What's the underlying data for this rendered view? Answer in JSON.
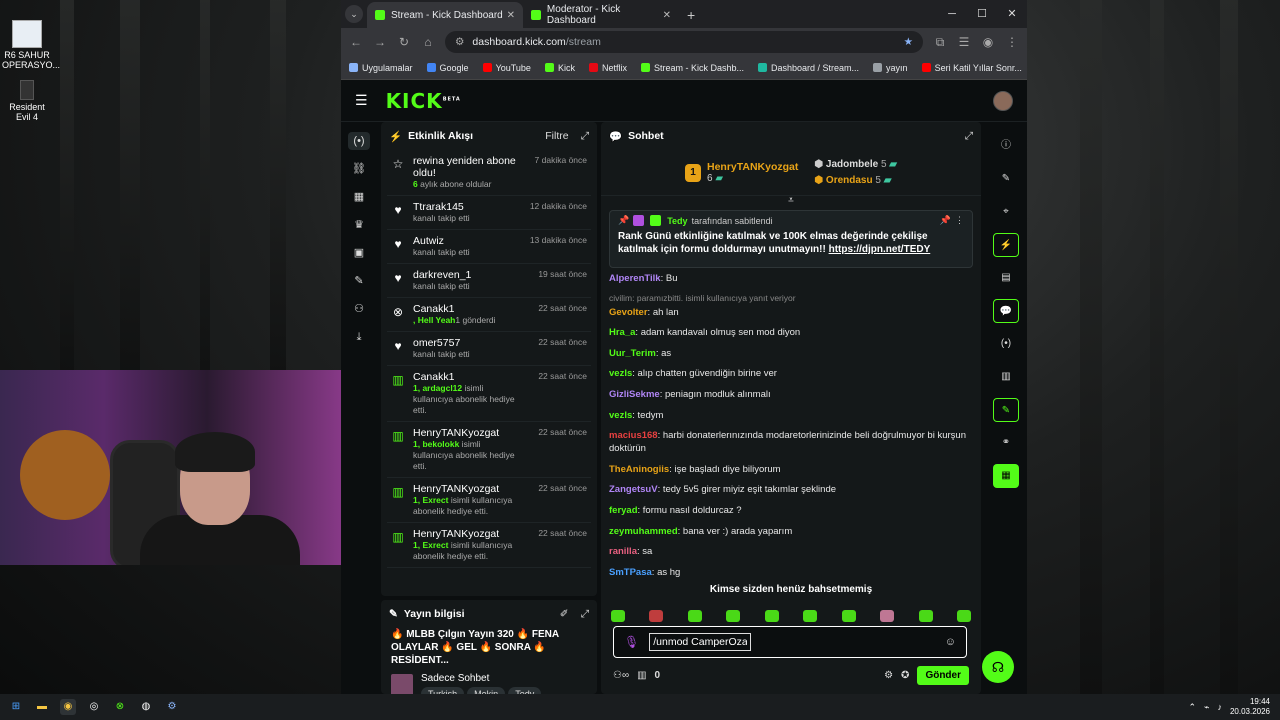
{
  "desktop": {
    "icons": [
      {
        "label": "R6 SAHUR OPERASYO..."
      },
      {
        "label": "Resident Evil 4"
      }
    ]
  },
  "browser": {
    "tabs": [
      {
        "label": "Stream - Kick Dashboard",
        "active": true
      },
      {
        "label": "Moderator - Kick Dashboard",
        "active": false
      }
    ],
    "url_domain": "dashboard.kick.com",
    "url_path": "/stream",
    "bookmarks": [
      {
        "label": "Uygulamalar",
        "color": "#8ab4f8"
      },
      {
        "label": "Google",
        "color": "#4285f4"
      },
      {
        "label": "YouTube",
        "color": "#ff0000"
      },
      {
        "label": "Kick",
        "color": "#53fc18"
      },
      {
        "label": "Netflix",
        "color": "#e50914"
      },
      {
        "label": "Stream - Kick Dashb...",
        "color": "#53fc18"
      },
      {
        "label": "Dashboard / Stream...",
        "color": "#1fb8a0"
      },
      {
        "label": "yayın",
        "color": "#9aa0a6"
      },
      {
        "label": "Seri Katil Yıllar Sonr...",
        "color": "#ff0000"
      }
    ]
  },
  "kick": {
    "logo": "KICK",
    "logo_sup": "BETA",
    "activity": {
      "title": "Etkinlik Akışı",
      "filter": "Filtre",
      "items": [
        {
          "title": "rewina yeniden abone oldu!",
          "sub_hl": "6",
          "sub": " aylık abone oldular",
          "time": "7 dakika önce",
          "icon": "star-icon"
        },
        {
          "title": "Ttrarak145",
          "sub_hl": "",
          "sub": "kanalı takip etti",
          "time": "12 dakika önce",
          "icon": "heart-icon"
        },
        {
          "title": "Autwiz",
          "sub_hl": "",
          "sub": "kanalı takip etti",
          "time": "13 dakika önce",
          "icon": "heart-icon"
        },
        {
          "title": "darkreven_1",
          "sub_hl": "",
          "sub": "kanalı takip etti",
          "time": "19 saat önce",
          "icon": "heart-icon"
        },
        {
          "title": "Canakk1",
          "sub_hl": ", Hell Yeah",
          "sub": "1 gönderdi",
          "time": "22 saat önce",
          "icon": "kick-coin-icon"
        },
        {
          "title": "omer5757",
          "sub_hl": "",
          "sub": "kanalı takip etti",
          "time": "22 saat önce",
          "icon": "heart-icon"
        },
        {
          "title": "Canakk1",
          "sub_hl": "1, ardagcl12",
          "sub": " isimli kullanıcıya abonelik hediye etti.",
          "time": "22 saat önce",
          "icon": "gift-icon"
        },
        {
          "title": "HenryTANKyozgat",
          "sub_hl": "1, bekolokk",
          "sub": " isimli kullanıcıya abonelik hediye etti.",
          "time": "22 saat önce",
          "icon": "gift-icon"
        },
        {
          "title": "HenryTANKyozgat",
          "sub_hl": "1, Exrect",
          "sub": " isimli kullanıcıya abonelik hediye etti.",
          "time": "22 saat önce",
          "icon": "gift-icon"
        },
        {
          "title": "HenryTANKyozgat",
          "sub_hl": "1, Exrect",
          "sub": " isimli kullanıcıya abonelik hediye etti.",
          "time": "22 saat önce",
          "icon": "gift-icon"
        }
      ]
    },
    "stream_info": {
      "title": "Yayın bilgisi",
      "stream_title": "🔥 MLBB Çılgın Yayın 320 🔥 FENA OLAYLAR 🔥 GEL 🔥 SONRA 🔥 RESİDENT...",
      "category": "Sadece Sohbet",
      "tags": [
        "Turkish",
        "Mekin",
        "Tedy"
      ]
    },
    "chat": {
      "title": "Sohbet",
      "leader": {
        "rank": "1",
        "name": "HenryTANKyozgat",
        "count": "6"
      },
      "runners": [
        {
          "name": "Jadombele",
          "count": "5",
          "color": "#dddddd"
        },
        {
          "name": "Orendasu",
          "count": "5",
          "color": "#e8a317"
        }
      ],
      "pinned_by": "Tedy",
      "pinned_by_suffix": " tarafından sabitlendi",
      "pinned_msg": "Rank Günü etkinliğine katılmak ve 100K elmas değerinde çekilişe katılmak için formu doldurmayı unutmayın!! ",
      "pinned_link": "https://djpn.net/TEDY",
      "reply_note": "civilim: paramızbitti. isimli kullanıcıya yanıt veriyor",
      "messages": [
        {
          "user": "AlperenTilk",
          "color": "#b085f5",
          "text": "Bu"
        },
        {
          "user": "Gevolter",
          "color": "#e8a317",
          "text": "ah lan"
        },
        {
          "user": "Hra_a",
          "color": "#53fc18",
          "text": "adam kandavalı olmuş sen mod diyon"
        },
        {
          "user": "Uur_Terim",
          "color": "#53fc18",
          "text": "as"
        },
        {
          "user": "vezls",
          "color": "#53fc18",
          "text": "alıp chatten güvendiğin birine ver"
        },
        {
          "user": "GizliSekme",
          "color": "#b085f5",
          "text": "peniagın modluk alınmalı"
        },
        {
          "user": "vezls",
          "color": "#53fc18",
          "text": "tedym"
        },
        {
          "user": "macius168",
          "color": "#e84040",
          "text": "harbi donaterlerınızında modaretorlerinizinde beli doğrulmuyor bi kurşun doktürün"
        },
        {
          "user": "TheAninogiis",
          "color": "#e8a317",
          "text": "işe başladı diye biliyorum"
        },
        {
          "user": "ZangetsuV",
          "color": "#b085f5",
          "text": "tedy 5v5 girer miyiz eşit takımlar şeklinde"
        },
        {
          "user": "feryad",
          "color": "#53fc18",
          "text": "formu nasıl doldurcaz ?"
        },
        {
          "user": "zeymuhammed",
          "color": "#53fc18",
          "text": "bana ver :) arada yaparım"
        },
        {
          "user": "ranilla",
          "color": "#e86080",
          "text": "sa"
        },
        {
          "user": "SmTPasa",
          "color": "#4aa0ff",
          "text": "as hg"
        }
      ],
      "no_mention": "Kimse sizden henüz bahsetmemiş",
      "input_value": "/unmod CamperOzan",
      "counter": "0",
      "send_label": "Gönder"
    }
  },
  "taskbar": {
    "time": "19:44",
    "date": "20.03.2026"
  }
}
